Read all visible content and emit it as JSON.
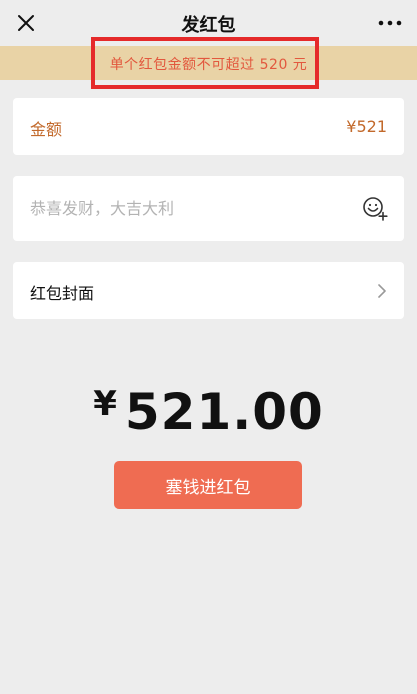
{
  "navbar": {
    "title": "发红包",
    "close_icon": "close-icon",
    "more_icon": "more-icon"
  },
  "warning": {
    "text": "单个红包金额不可超过 520 元",
    "banner_color": "#e9d3a6",
    "text_color": "#e2583e",
    "highlight_color": "#e52a2a"
  },
  "amount": {
    "label": "金额",
    "value": "¥521",
    "color": "#c2692b"
  },
  "greeting": {
    "value": "",
    "placeholder": "恭喜发财，大吉大利",
    "emoji_icon": "emoji-add-icon"
  },
  "cover": {
    "label": "红包封面",
    "chevron_icon": "chevron-right-icon"
  },
  "total": {
    "symbol": "¥",
    "amount": "521.00"
  },
  "send_button": {
    "label": "塞钱进红包",
    "color": "#ef6c52"
  }
}
